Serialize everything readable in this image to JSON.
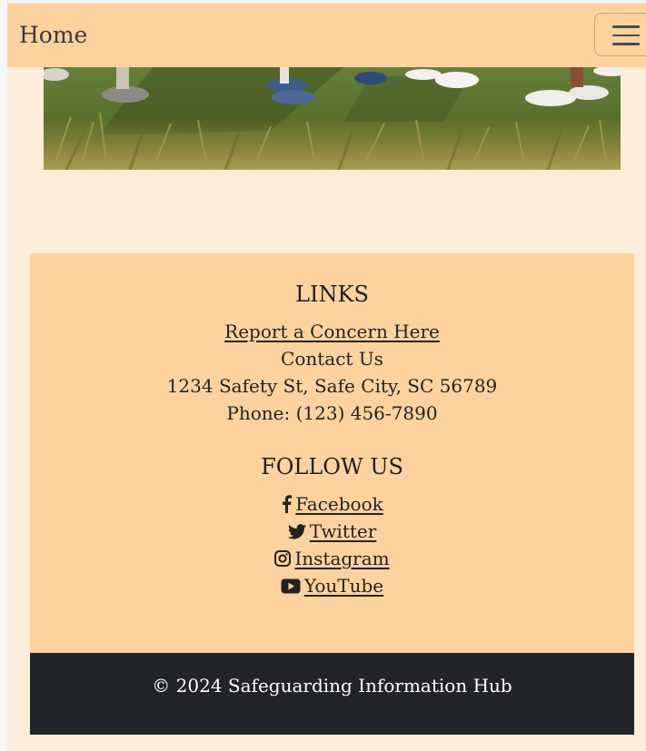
{
  "navbar": {
    "brand": "Home",
    "toggler_icon": "hamburger-menu-icon",
    "background": "#fed29e"
  },
  "hero": {
    "description_icon": "children-feet-on-grass-image"
  },
  "footer": {
    "links_heading": "LINKS",
    "report_link": "Report a Concern Here",
    "contact": "Contact Us",
    "address": "1234 Safety St, Safe City, SC 56789",
    "phone": "Phone: (123) 456-7890",
    "follow_heading": "FOLLOW US",
    "social": [
      {
        "label": " Facebook",
        "icon": "facebook-icon"
      },
      {
        "label": " Twitter",
        "icon": "twitter-icon"
      },
      {
        "label": " Instagram",
        "icon": "instagram-icon"
      },
      {
        "label": " YouTube",
        "icon": "youtube-icon"
      }
    ],
    "background": "#fed29e"
  },
  "copyright": {
    "text": "© 2024 Safeguarding Information Hub",
    "background": "#212529"
  },
  "page_background": "#ffeddb"
}
